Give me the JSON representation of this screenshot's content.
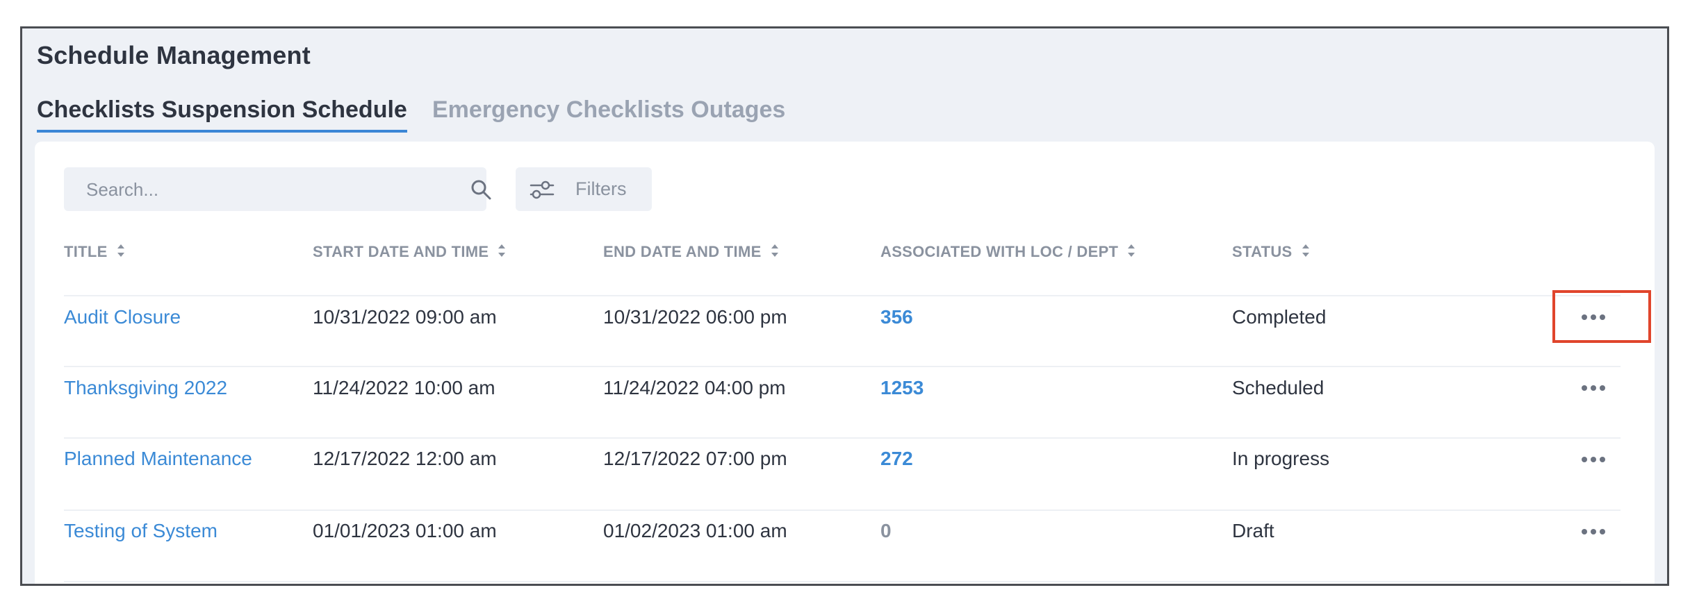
{
  "page": {
    "title": "Schedule Management"
  },
  "tabs": [
    {
      "label": "Checklists Suspension Schedule",
      "active": true
    },
    {
      "label": "Emergency Checklists Outages",
      "active": false
    }
  ],
  "toolbar": {
    "search_placeholder": "Search...",
    "search_icon": "search-icon",
    "filters_label": "Filters",
    "filters_icon": "sliders-icon"
  },
  "table": {
    "columns": [
      {
        "label": "TITLE",
        "sortable": true
      },
      {
        "label": "START DATE AND TIME",
        "sortable": true
      },
      {
        "label": "END DATE AND TIME",
        "sortable": true
      },
      {
        "label": "ASSOCIATED WITH LOC / DEPT",
        "sortable": true
      },
      {
        "label": "STATUS",
        "sortable": true
      }
    ],
    "rows": [
      {
        "title": "Audit Closure",
        "start": "10/31/2022  09:00 am",
        "end": "10/31/2022  06:00 pm",
        "associated": "356",
        "status": "Completed"
      },
      {
        "title": "Thanksgiving 2022",
        "start": "11/24/2022  10:00 am",
        "end": "11/24/2022  04:00 pm",
        "associated": "1253",
        "status": "Scheduled"
      },
      {
        "title": "Planned Maintenance",
        "start": "12/17/2022  12:00 am",
        "end": "12/17/2022  07:00 pm",
        "associated": "272",
        "status": "In progress"
      },
      {
        "title": "Testing of System",
        "start": "01/01/2023  01:00 am",
        "end": "01/02/2023  01:00 am",
        "associated": "0",
        "status": "Draft"
      }
    ],
    "row_action_icon": "more-horizontal-icon"
  },
  "colors": {
    "accent": "#3b86d6",
    "link": "#3b8ad6",
    "highlight": "#e0452c",
    "background": "#eef1f6"
  }
}
